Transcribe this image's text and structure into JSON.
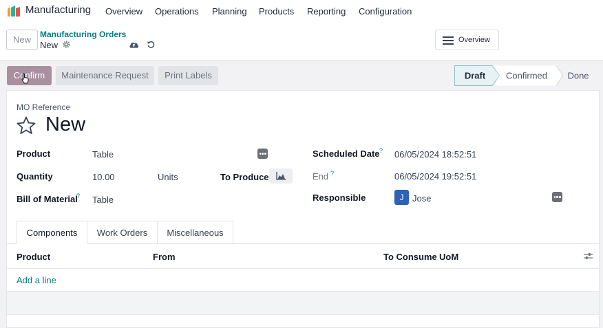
{
  "app": {
    "name": "Manufacturing",
    "menu": [
      "Overview",
      "Operations",
      "Planning",
      "Products",
      "Reporting",
      "Configuration"
    ]
  },
  "control": {
    "new_label": "New",
    "breadcrumb": "Manufacturing Orders",
    "record": "New",
    "overview_label": "Overview"
  },
  "actions": {
    "confirm": "Confirm",
    "maintenance": "Maintenance Request",
    "print_labels": "Print Labels"
  },
  "status": {
    "steps": [
      "Draft",
      "Confirmed",
      "Done"
    ],
    "current": "Draft"
  },
  "form": {
    "mo_reference_label": "MO Reference",
    "title": "New",
    "product_label": "Product",
    "product_value": "Table",
    "quantity_label": "Quantity",
    "quantity_value": "10.00",
    "uom_value": "Units",
    "to_produce_label": "To Produce",
    "bom_label": "Bill of Material",
    "bom_value": "Table",
    "scheduled_label": "Scheduled Date",
    "scheduled_value": "06/05/2024 18:52:51",
    "end_label": "End",
    "end_value": "06/05/2024 19:52:51",
    "responsible_label": "Responsible",
    "responsible_initial": "J",
    "responsible_value": "Jose",
    "help_mark": "?"
  },
  "tabs": [
    "Components",
    "Work Orders",
    "Miscellaneous"
  ],
  "table": {
    "headers": [
      "Product",
      "From",
      "To Consume",
      "UoM"
    ],
    "add_line": "Add a line"
  },
  "colors": {
    "accent": "#017e84",
    "confirm_button": "#a9909f",
    "avatar": "#2d62b6"
  },
  "icons": [
    "app-logo-icon",
    "gear-icon",
    "cloud-upload-icon",
    "undo-icon",
    "hamburger-icon",
    "star-icon",
    "more-dots-icon",
    "chart-icon",
    "sliders-icon",
    "cursor-icon"
  ]
}
